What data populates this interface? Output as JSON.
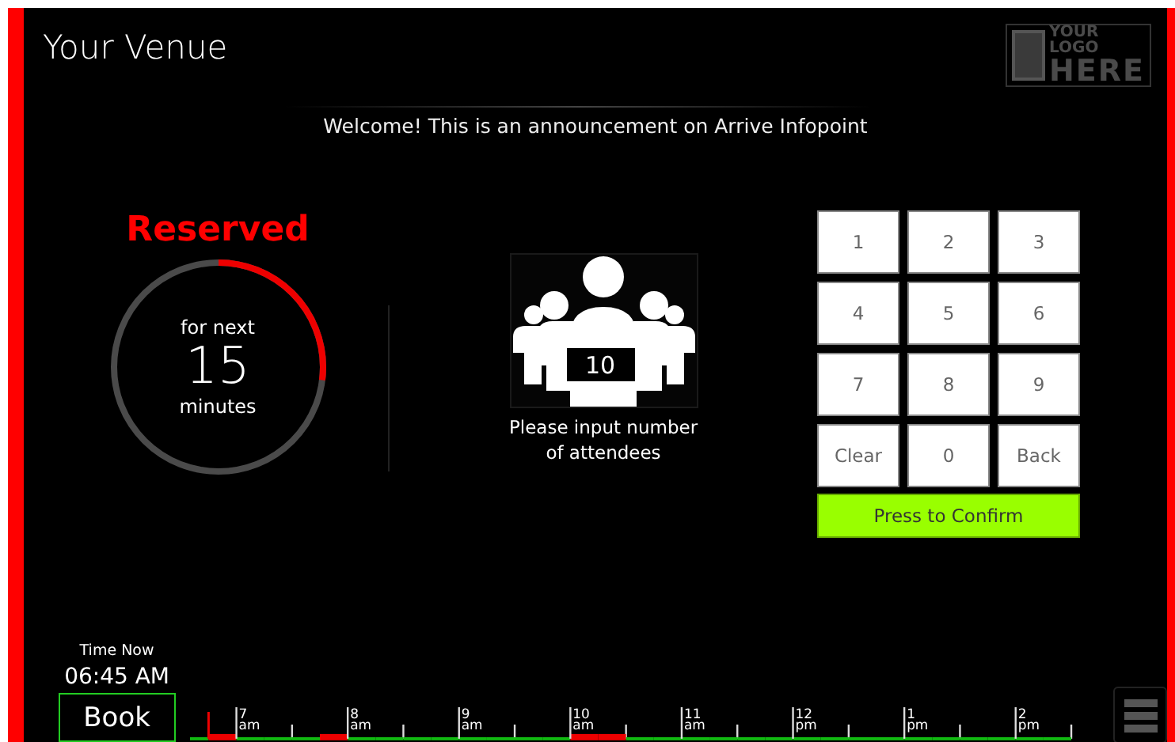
{
  "header": {
    "venue": "Your Venue",
    "logo": [
      "YOUR LOGO",
      "HERE"
    ]
  },
  "announcement": "Welcome! This is an announcement on Arrive Infopoint",
  "status": {
    "label": "Reserved",
    "prefix": "for next",
    "minutes": "15",
    "unit": "minutes"
  },
  "attendees": {
    "value": "10",
    "prompt": "Please input number of attendees"
  },
  "keypad": {
    "keys": [
      "1",
      "2",
      "3",
      "4",
      "5",
      "6",
      "7",
      "8",
      "9",
      "Clear",
      "0",
      "Back"
    ],
    "confirm": "Press to Confirm"
  },
  "clock": {
    "label": "Time Now",
    "time": "06:45 AM"
  },
  "book_button": "Book",
  "timeline": {
    "hours": [
      {
        "hour": "7",
        "period": "am"
      },
      {
        "hour": "8",
        "period": "am"
      },
      {
        "hour": "9",
        "period": "am"
      },
      {
        "hour": "10",
        "period": "am"
      },
      {
        "hour": "11",
        "period": "am"
      },
      {
        "hour": "12",
        "period": "pm"
      },
      {
        "hour": "1",
        "period": "pm"
      },
      {
        "hour": "2",
        "period": "pm"
      }
    ],
    "slots": [
      {
        "booked": false
      },
      {
        "booked": true
      },
      {
        "booked": false
      },
      {
        "booked": false
      },
      {
        "booked": false
      },
      {
        "booked": true
      },
      {
        "booked": false
      },
      {
        "booked": false
      },
      {
        "booked": false
      },
      {
        "booked": false
      },
      {
        "booked": false
      },
      {
        "booked": false
      },
      {
        "booked": false
      },
      {
        "booked": false
      },
      {
        "booked": true
      },
      {
        "booked": true
      },
      {
        "booked": false
      },
      {
        "booked": false
      },
      {
        "booked": false
      },
      {
        "booked": false
      },
      {
        "booked": false
      },
      {
        "booked": false
      },
      {
        "booked": false
      },
      {
        "booked": false
      },
      {
        "booked": false
      },
      {
        "booked": false
      },
      {
        "booked": false
      },
      {
        "booked": false
      },
      {
        "booked": false
      },
      {
        "booked": false
      },
      {
        "booked": false
      },
      {
        "booked": false
      }
    ]
  }
}
